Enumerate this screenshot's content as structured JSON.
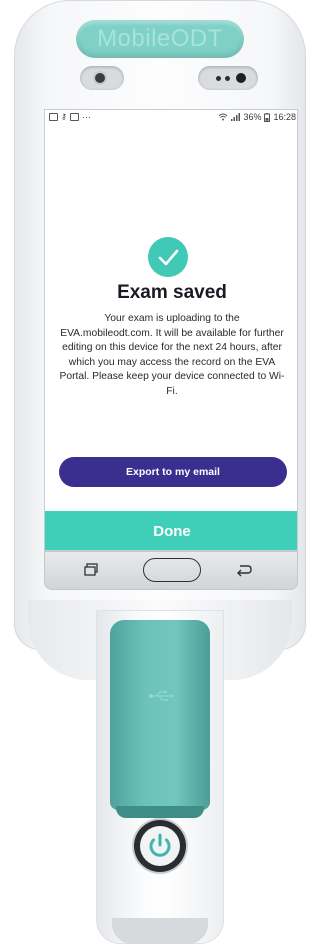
{
  "device": {
    "brand": "MobileODT"
  },
  "status_bar": {
    "battery_percent": "36%",
    "time": "16:28"
  },
  "dialog": {
    "title": "Exam saved",
    "message": "Your exam is uploading to the EVA.mobileodt.com. It will be available for further editing on this device for the next 24 hours, after which you may access the record on the EVA Portal. Please keep your device connected to Wi-Fi.",
    "icon": "check-circle-icon"
  },
  "buttons": {
    "export": "Export to my email",
    "done": "Done"
  },
  "colors": {
    "accent_teal": "#3fcfb8",
    "export_purple": "#3a2f8f",
    "check_teal": "#3fc9b6"
  }
}
